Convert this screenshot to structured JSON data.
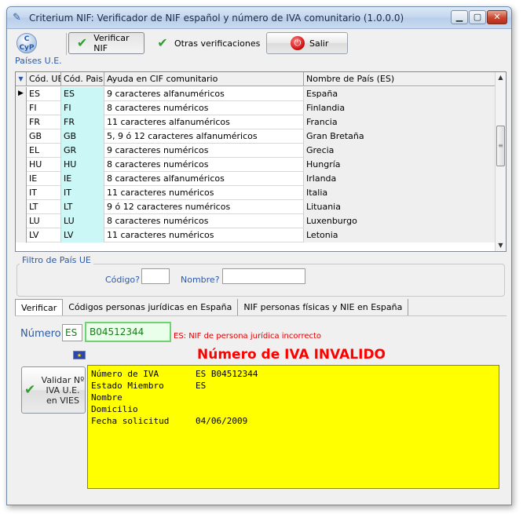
{
  "window": {
    "title": "Criterium NIF: Verificador de NIF español y número de IVA comunitario (1.0.0.0)"
  },
  "toolbar": {
    "logo_text": "C\nCyP",
    "verificar_nif": "Verificar NIF",
    "otras_verificaciones": "Otras verificaciones",
    "salir": "Salir"
  },
  "paises": {
    "label": "Países U.E.",
    "columns": [
      "Cód. UE",
      "Cód. Pais",
      "Ayuda en CIF comunitario",
      "Nombre de País (ES)"
    ],
    "rows": [
      {
        "ue": "ES",
        "pais": "ES",
        "ayuda": "9 caracteres alfanuméricos",
        "nombre": "España",
        "current": true
      },
      {
        "ue": "FI",
        "pais": "FI",
        "ayuda": "8 caracteres numéricos",
        "nombre": "Finlandia"
      },
      {
        "ue": "FR",
        "pais": "FR",
        "ayuda": "11 caracteres alfanuméricos",
        "nombre": "Francia"
      },
      {
        "ue": "GB",
        "pais": "GB",
        "ayuda": "5, 9 ó 12 caracteres alfanuméricos",
        "nombre": "Gran Bretaña"
      },
      {
        "ue": "EL",
        "pais": "GR",
        "ayuda": "9 caracteres numéricos",
        "nombre": "Grecia"
      },
      {
        "ue": "HU",
        "pais": "HU",
        "ayuda": "8 caracteres numéricos",
        "nombre": "Hungría"
      },
      {
        "ue": "IE",
        "pais": "IE",
        "ayuda": "8 caracteres alfanuméricos",
        "nombre": "Irlanda"
      },
      {
        "ue": "IT",
        "pais": "IT",
        "ayuda": "11 caracteres numéricos",
        "nombre": "Italia"
      },
      {
        "ue": "LT",
        "pais": "LT",
        "ayuda": "9 ó 12 caracteres numéricos",
        "nombre": "Lituania"
      },
      {
        "ue": "LU",
        "pais": "LU",
        "ayuda": "8 caracteres numéricos",
        "nombre": "Luxenburgo"
      },
      {
        "ue": "LV",
        "pais": "LV",
        "ayuda": "11 caracteres numéricos",
        "nombre": "Letonia"
      }
    ]
  },
  "filtro": {
    "title": "Filtro de País UE",
    "codigo_label": "Código?",
    "codigo_value": "",
    "nombre_label": "Nombre?",
    "nombre_value": ""
  },
  "tabs": [
    "Verificar",
    "Códigos personas jurídicas en España",
    "NIF personas físicas y NIE en España"
  ],
  "verificar": {
    "numero_label": "Número:",
    "country_code": "ES",
    "nif_value": "B04512344",
    "error_text": "ES: NIF de persona jurídica incorrecto",
    "result_title": "Número de IVA INVALIDO",
    "vies_button": "Validar Nº IVA U.E. en VIES",
    "result_lines": [
      {
        "key": "Número de IVA",
        "value": "ES B04512344"
      },
      {
        "key": "Estado Miembro",
        "value": "ES"
      },
      {
        "key": "Nombre",
        "value": ""
      },
      {
        "key": "Domicilio",
        "value": ""
      },
      {
        "key": "Fecha solicitud",
        "value": "04/06/2009"
      }
    ]
  },
  "colors": {
    "accent": "#2a5aa8",
    "error": "#ff0000",
    "result_bg": "#ffff00",
    "valid_green": "#6fd36f"
  }
}
